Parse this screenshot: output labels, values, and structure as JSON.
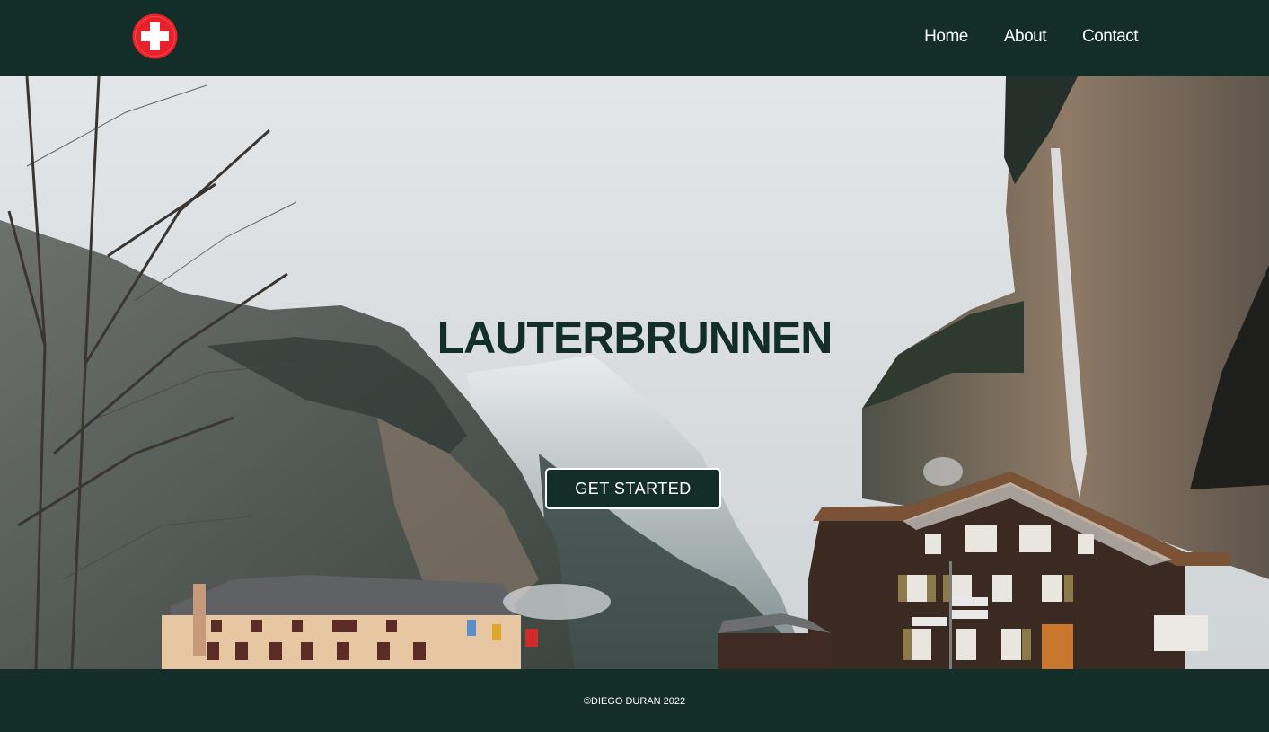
{
  "header": {
    "logo_icon": "swiss-cross-icon",
    "nav": [
      {
        "label": "Home"
      },
      {
        "label": "About"
      },
      {
        "label": "Contact"
      }
    ]
  },
  "hero": {
    "title": "LAUTERBRUNNEN",
    "cta_label": "GET STARTED"
  },
  "footer": {
    "copyright": "©DIEGO DURAN 2022"
  },
  "colors": {
    "brand_dark": "#132e28",
    "logo_red": "#e8212a",
    "text_light": "#ffffff"
  }
}
